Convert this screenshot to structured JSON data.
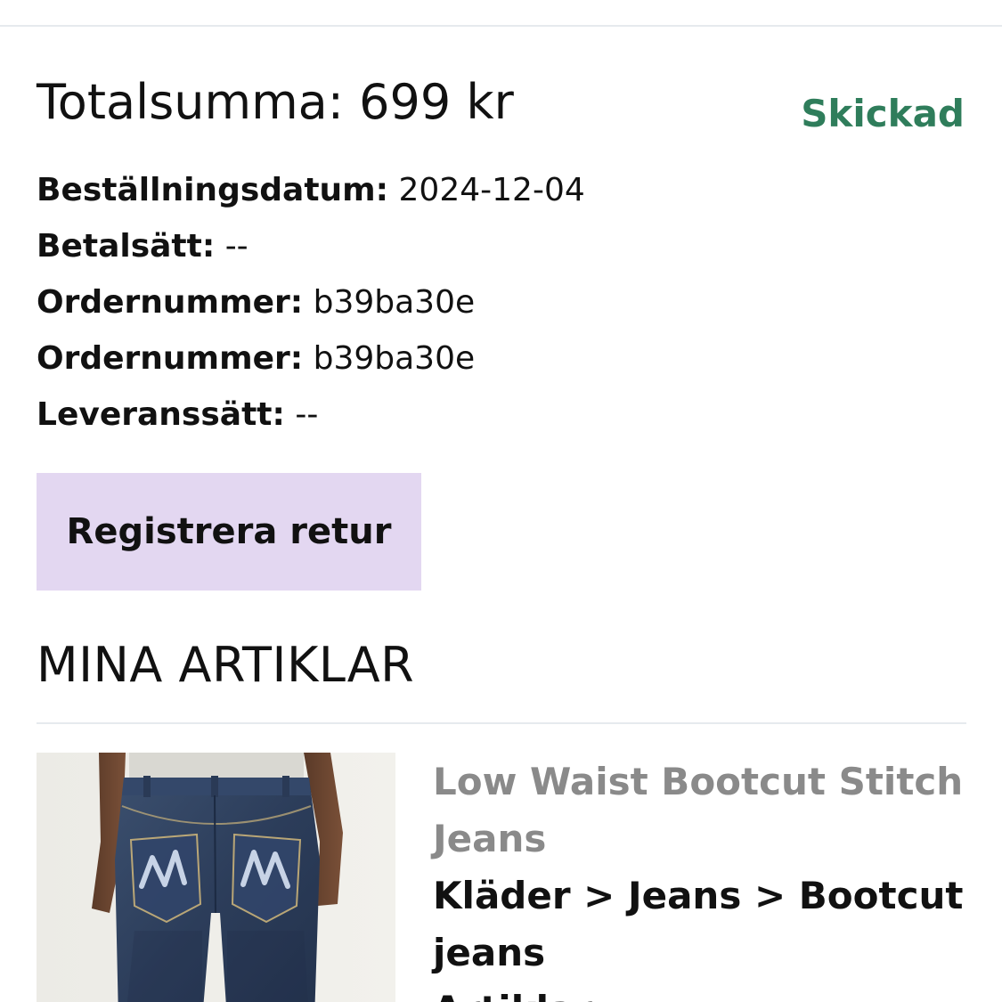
{
  "order": {
    "total": "Totalsumma: 699 kr",
    "status": "Skickad",
    "status_color": "#2f7d5b",
    "details": [
      {
        "label": "Beställningsdatum:",
        "value": "2024-12-04"
      },
      {
        "label": "Betalsätt:",
        "value": "--"
      },
      {
        "label": "Ordernummer:",
        "value": "b39ba30e"
      },
      {
        "label": "Ordernummer:",
        "value": "b39ba30e"
      },
      {
        "label": "Leveranssätt:",
        "value": "--"
      }
    ],
    "return_button": "Registrera retur",
    "return_button_color": "#e3d7f1"
  },
  "items_section": {
    "title": "MINA ARTIKLAR",
    "items": [
      {
        "image": "jeans-photo",
        "name": "Low Waist Bootcut Stitch Jeans",
        "category": "Kläder > Jeans > Bootcut jeans",
        "extra": "Artiklar"
      }
    ]
  }
}
